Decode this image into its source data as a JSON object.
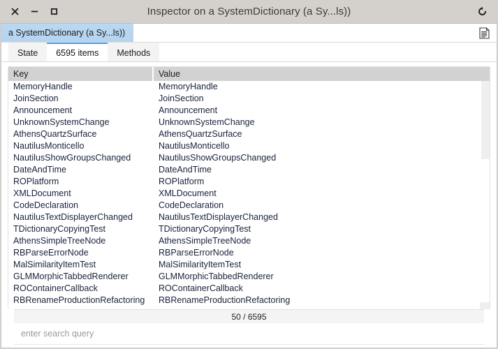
{
  "window": {
    "title": "Inspector on a SystemDictionary (a Sy...ls))",
    "controls": {
      "close_label": "×",
      "minimize_label": "−",
      "maximize_label": "□"
    },
    "history_icon": "revert-arrow-icon"
  },
  "breadcrumb": {
    "items": [
      {
        "label": "a SystemDictionary (a Sy...ls))"
      }
    ],
    "action_icon": "document-list-icon"
  },
  "tabs": [
    {
      "label": "State",
      "selected": false
    },
    {
      "label": "6595 items",
      "selected": true
    },
    {
      "label": "Methods",
      "selected": false
    }
  ],
  "table": {
    "columns": [
      {
        "label": "Key"
      },
      {
        "label": "Value"
      }
    ],
    "rows": [
      {
        "key": "MemoryHandle",
        "value": "MemoryHandle"
      },
      {
        "key": "JoinSection",
        "value": "JoinSection"
      },
      {
        "key": "Announcement",
        "value": "Announcement"
      },
      {
        "key": "UnknownSystemChange",
        "value": "UnknownSystemChange"
      },
      {
        "key": "AthensQuartzSurface",
        "value": "AthensQuartzSurface"
      },
      {
        "key": "NautilusMonticello",
        "value": "NautilusMonticello"
      },
      {
        "key": "NautilusShowGroupsChanged",
        "value": "NautilusShowGroupsChanged"
      },
      {
        "key": "DateAndTime",
        "value": "DateAndTime"
      },
      {
        "key": "ROPlatform",
        "value": "ROPlatform"
      },
      {
        "key": "XMLDocument",
        "value": "XMLDocument"
      },
      {
        "key": "CodeDeclaration",
        "value": "CodeDeclaration"
      },
      {
        "key": "NautilusTextDisplayerChanged",
        "value": "NautilusTextDisplayerChanged"
      },
      {
        "key": "TDictionaryCopyingTest",
        "value": "TDictionaryCopyingTest"
      },
      {
        "key": "AthensSimpleTreeNode",
        "value": "AthensSimpleTreeNode"
      },
      {
        "key": "RBParseErrorNode",
        "value": "RBParseErrorNode"
      },
      {
        "key": "MalSimilarityItemTest",
        "value": "MalSimilarityItemTest"
      },
      {
        "key": "GLMMorphicTabbedRenderer",
        "value": "GLMMorphicTabbedRenderer"
      },
      {
        "key": "ROContainerCallback",
        "value": "ROContainerCallback"
      },
      {
        "key": "RBRenameProductionRefactoring",
        "value": "RBRenameProductionRefactoring"
      }
    ]
  },
  "status": {
    "count_label": "50 / 6595"
  },
  "search": {
    "value": "",
    "placeholder": "enter search query"
  },
  "colors": {
    "titlebar_bg": "#d4d0cb",
    "title_text": "#3f3a33",
    "crumb_bg": "#b8d6f0",
    "tab_selected_accent": "#4a9fe0",
    "header_bg": "#d2d2d2",
    "row_text": "#17223b",
    "status_bg": "#f4f4f4",
    "scroll_thumb": "#efefef"
  }
}
